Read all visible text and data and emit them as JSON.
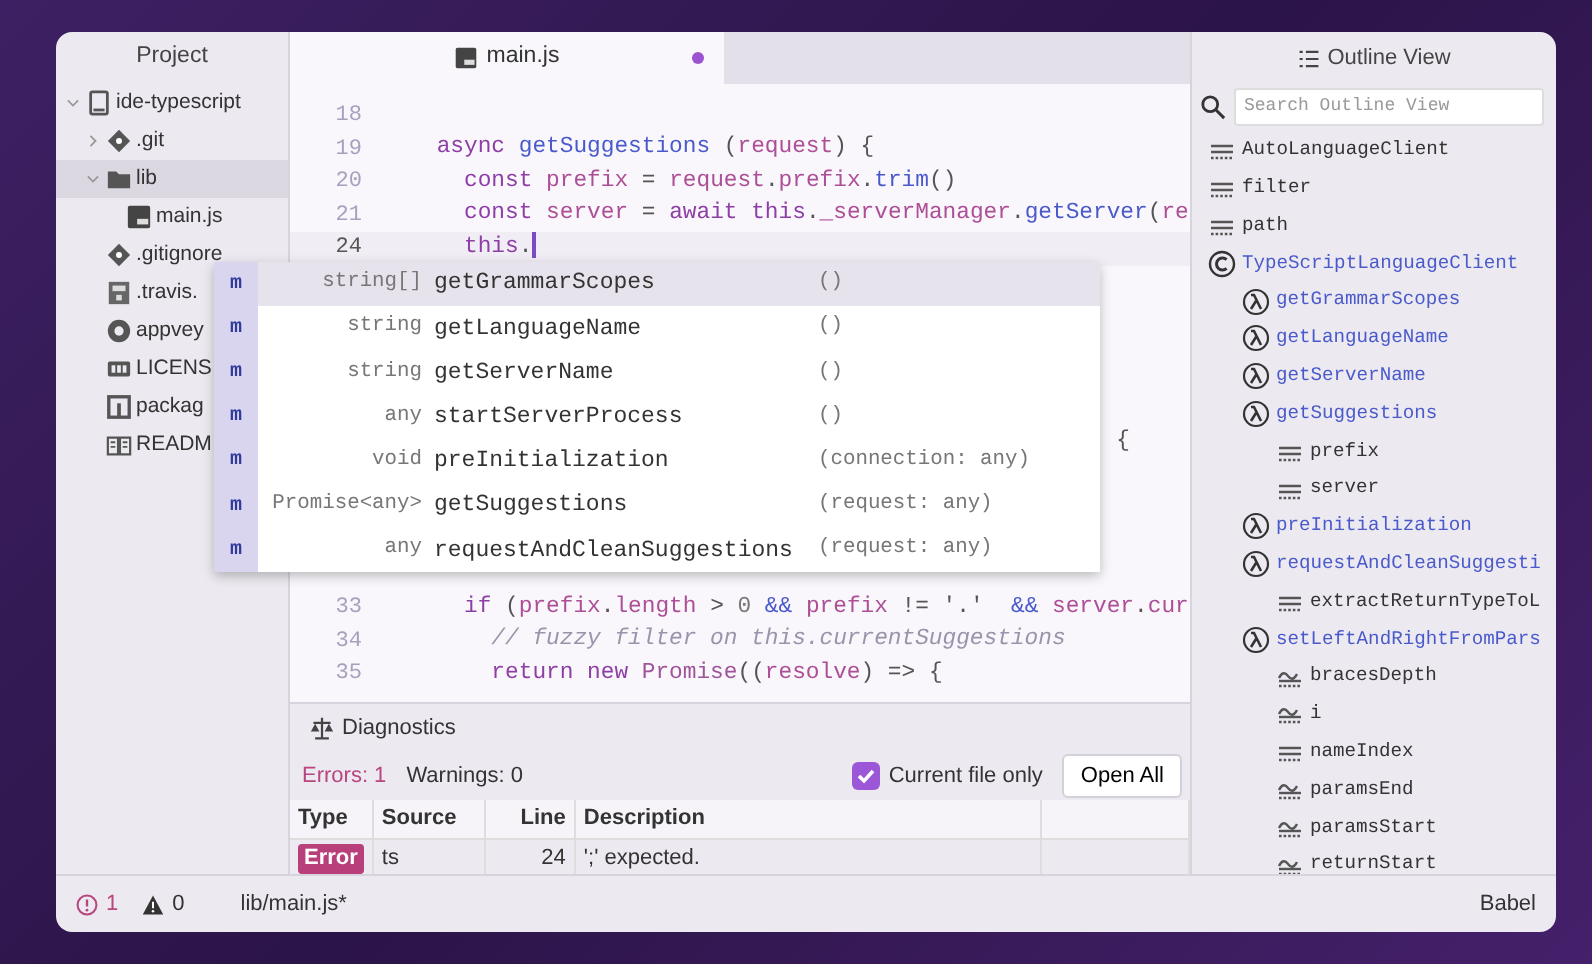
{
  "project_panel": {
    "title": "Project",
    "tree": [
      {
        "name": "ide-typescript",
        "kind": "repo",
        "expanded": true,
        "selected": false,
        "children": [
          {
            "name": ".git",
            "kind": "git",
            "expanded": false,
            "selected": false
          },
          {
            "name": "lib",
            "kind": "folder",
            "expanded": true,
            "selected": true,
            "children": [
              {
                "name": "main.js",
                "kind": "js",
                "selected": false
              }
            ]
          },
          {
            "name": ".gitignore",
            "kind": "git",
            "selected": false
          },
          {
            "name": ".travis.",
            "kind": "config",
            "selected": false
          },
          {
            "name": "appvey",
            "kind": "ci",
            "selected": false
          },
          {
            "name": "LICENS",
            "kind": "license",
            "selected": false
          },
          {
            "name": "packag",
            "kind": "package",
            "selected": false
          },
          {
            "name": "READM",
            "kind": "readme",
            "selected": false
          }
        ]
      }
    ]
  },
  "editor": {
    "tab": {
      "title": "main.js",
      "modified": true
    },
    "lines": [
      {
        "number": "18",
        "current": false
      },
      {
        "number": "19",
        "current": false,
        "tokens": [
          {
            "kind": "keyword",
            "text": "    async"
          },
          {
            "kind": "function",
            "text": " getSuggestions"
          },
          {
            "kind": "plain",
            "text": " ("
          },
          {
            "kind": "variable",
            "text": "request"
          },
          {
            "kind": "plain",
            "text": ") {"
          }
        ]
      },
      {
        "number": "20",
        "current": false,
        "tokens": [
          {
            "kind": "keyword",
            "text": "      const"
          },
          {
            "kind": "variable",
            "text": " prefix"
          },
          {
            "kind": "plain",
            "text": " = "
          },
          {
            "kind": "variable",
            "text": "request"
          },
          {
            "kind": "plain",
            "text": "."
          },
          {
            "kind": "variable",
            "text": "prefix"
          },
          {
            "kind": "plain",
            "text": "."
          },
          {
            "kind": "function",
            "text": "trim"
          },
          {
            "kind": "plain",
            "text": "()"
          }
        ]
      },
      {
        "number": "21",
        "current": false,
        "tokens": [
          {
            "kind": "keyword",
            "text": "      const"
          },
          {
            "kind": "variable",
            "text": " server"
          },
          {
            "kind": "plain",
            "text": " = "
          },
          {
            "kind": "keyword",
            "text": "await this"
          },
          {
            "kind": "plain",
            "text": "."
          },
          {
            "kind": "variable",
            "text": "_serverManager"
          },
          {
            "kind": "plain",
            "text": "."
          },
          {
            "kind": "function",
            "text": "getServer"
          },
          {
            "kind": "plain",
            "text": "("
          },
          {
            "kind": "variable",
            "text": "re"
          }
        ]
      },
      {
        "number": "24",
        "current": true,
        "tokens": [
          {
            "kind": "keyword",
            "text": "      this"
          },
          {
            "kind": "plain",
            "text": "."
          }
        ]
      }
    ],
    "hidden_fragment": "{",
    "lines_after": [
      {
        "number": "33",
        "current": false,
        "tokens": [
          {
            "kind": "keyword",
            "text": "      if"
          },
          {
            "kind": "plain",
            "text": " ("
          },
          {
            "kind": "variable",
            "text": "prefix"
          },
          {
            "kind": "plain",
            "text": "."
          },
          {
            "kind": "variable",
            "text": "length"
          },
          {
            "kind": "plain",
            "text": " > "
          },
          {
            "kind": "number",
            "text": "0"
          },
          {
            "kind": "operator",
            "text": " &&"
          },
          {
            "kind": "variable",
            "text": " prefix"
          },
          {
            "kind": "plain",
            "text": " != '.'"
          },
          {
            "kind": "operator",
            "text": "  &&"
          },
          {
            "kind": "variable",
            "text": " server"
          },
          {
            "kind": "plain",
            "text": "."
          },
          {
            "kind": "variable",
            "text": "cur"
          }
        ]
      },
      {
        "number": "34",
        "current": false,
        "tokens": [
          {
            "kind": "comment",
            "text": "        // fuzzy filter on this.currentSuggestions"
          }
        ]
      },
      {
        "number": "35",
        "current": false,
        "tokens": [
          {
            "kind": "keyword",
            "text": "        return new"
          },
          {
            "kind": "class",
            "text": " Promise"
          },
          {
            "kind": "plain",
            "text": "(("
          },
          {
            "kind": "variable",
            "text": "resolve"
          },
          {
            "kind": "plain",
            "text": ") => {"
          }
        ]
      }
    ]
  },
  "autocomplete": {
    "items": [
      {
        "icon": "m",
        "type": "string[]",
        "name": "getGrammarScopes",
        "params": "()",
        "selected": true
      },
      {
        "icon": "m",
        "type": "string",
        "name": "getLanguageName",
        "params": "()",
        "selected": false
      },
      {
        "icon": "m",
        "type": "string",
        "name": "getServerName",
        "params": "()",
        "selected": false
      },
      {
        "icon": "m",
        "type": "any",
        "name": "startServerProcess",
        "params": "()",
        "selected": false
      },
      {
        "icon": "m",
        "type": "void",
        "name": "preInitialization",
        "params": "(connection: any)",
        "selected": false
      },
      {
        "icon": "m",
        "type": "Promise<any>",
        "name": "getSuggestions",
        "params": "(request: any)",
        "selected": false
      },
      {
        "icon": "m",
        "type": "any",
        "name": "requestAndCleanSuggestions",
        "params": "(request: any)",
        "selected": false
      }
    ]
  },
  "diagnostics": {
    "title": "Diagnostics",
    "errors": "Errors: 1",
    "warnings": "Warnings: 0",
    "current_file_only": {
      "label": "Current file only",
      "checked": true
    },
    "open_all": "Open All",
    "table": {
      "columns": [
        "Type",
        "Source",
        "Line",
        "Description"
      ],
      "rows": [
        {
          "type": "Error",
          "source": "ts",
          "line": "24",
          "description": "';' expected."
        }
      ]
    }
  },
  "outline": {
    "title": "Outline View",
    "search": {
      "placeholder": "Search Outline View"
    },
    "items": [
      {
        "name": "AutoLanguageClient",
        "kind": "field"
      },
      {
        "name": "filter",
        "kind": "field"
      },
      {
        "name": "path",
        "kind": "field"
      },
      {
        "name": "TypeScriptLanguageClient",
        "kind": "class",
        "children": [
          {
            "name": "getGrammarScopes",
            "kind": "method"
          },
          {
            "name": "getLanguageName",
            "kind": "method"
          },
          {
            "name": "getServerName",
            "kind": "method"
          },
          {
            "name": "getSuggestions",
            "kind": "method",
            "children": [
              {
                "name": "prefix",
                "kind": "field"
              },
              {
                "name": "server",
                "kind": "field"
              }
            ]
          },
          {
            "name": "preInitialization",
            "kind": "method"
          },
          {
            "name": "requestAndCleanSuggesti",
            "kind": "method",
            "children": [
              {
                "name": "extractReturnTypeToL",
                "kind": "field"
              }
            ]
          },
          {
            "name": "setLeftAndRightFromPars",
            "kind": "method",
            "children": [
              {
                "name": "bracesDepth",
                "kind": "variable"
              },
              {
                "name": "i",
                "kind": "variable"
              },
              {
                "name": "nameIndex",
                "kind": "field"
              },
              {
                "name": "paramsEnd",
                "kind": "variable"
              },
              {
                "name": "paramsStart",
                "kind": "variable"
              },
              {
                "name": "returnStart",
                "kind": "variable"
              }
            ]
          }
        ]
      }
    ]
  },
  "status_bar": {
    "errors": "1",
    "warnings": "0",
    "file": "lib/main.js*",
    "grammar": "Babel"
  }
}
